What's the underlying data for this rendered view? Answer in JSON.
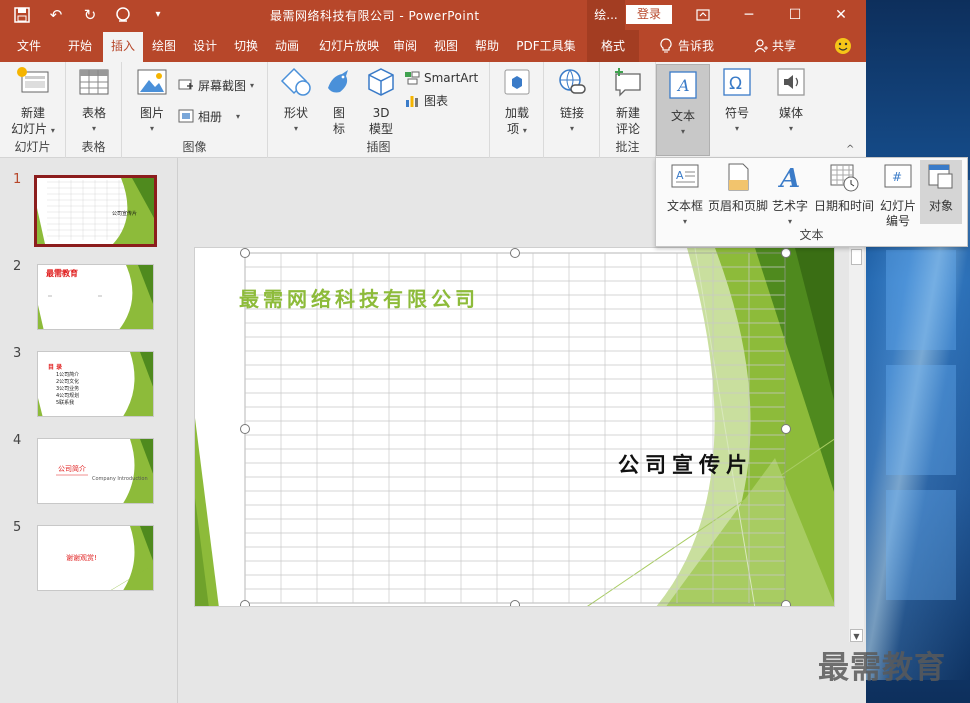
{
  "window": {
    "title": "最需网络科技有限公司  -  PowerPoint",
    "context_label": "绘...",
    "login": "登录"
  },
  "tabs": [
    "文件",
    "开始",
    "插入",
    "绘图",
    "设计",
    "切换",
    "动画",
    "幻灯片放映",
    "审阅",
    "视图",
    "帮助",
    "PDF工具集",
    "格式"
  ],
  "tell_me": "告诉我",
  "share": "共享",
  "ribbon": {
    "new_slide": {
      "line1": "新建",
      "line2": "幻灯片"
    },
    "group_slides": "幻灯片",
    "table": "表格",
    "group_table": "表格",
    "pictures": "图片",
    "screenshot": "屏幕截图",
    "album": "相册",
    "group_images": "图像",
    "shapes": "形状",
    "icons": {
      "line1": "图",
      "line2": "标"
    },
    "model3d": {
      "line1": "3D",
      "line2": "模型"
    },
    "smartart": "SmartArt",
    "chart": "图表",
    "group_illustrations": "插图",
    "addins": {
      "line1": "加载",
      "line2": "项"
    },
    "links": "链接",
    "new_comment": {
      "line1": "新建",
      "line2": "评论"
    },
    "group_comments": "批注",
    "text": "文本",
    "symbols": "符号",
    "media": "媒体"
  },
  "dropdown": {
    "items": [
      {
        "label": "文本框"
      },
      {
        "label": "页眉和页脚"
      },
      {
        "label": "艺术字"
      },
      {
        "label": "日期和时间"
      },
      {
        "line1": "幻灯片",
        "line2": "编号"
      },
      {
        "label": "对象"
      }
    ],
    "group_label": "文本"
  },
  "thumbnails": {
    "numbers": [
      "1",
      "2",
      "3",
      "4",
      "5"
    ],
    "t2_title": "最需教育",
    "t3_title": "目 录",
    "t3_items": [
      "1公司简介",
      "2公司文化",
      "3公司业务",
      "4公司规划",
      "5联系我"
    ],
    "t4_title": "公司简介",
    "t4_sub": "Company Introduction",
    "t5_title": "谢谢观赏!"
  },
  "slide": {
    "title": "最需网络科技有限公司",
    "subtitle": "公司宣传片"
  },
  "watermark": "最需教育",
  "colors": {
    "brand": "#b7472a",
    "green": "#8dbb3a",
    "dark_green": "#4f8a1e"
  }
}
